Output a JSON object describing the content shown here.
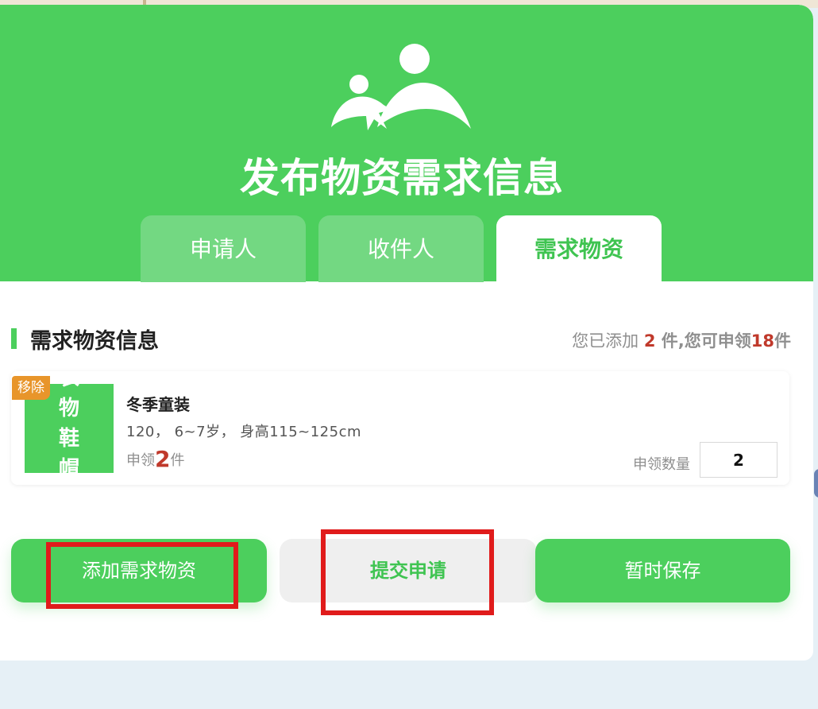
{
  "header": {
    "title": "发布物资需求信息",
    "logo_icon": "people-logo-icon",
    "background_color": "#4ccf5d"
  },
  "tabs": [
    {
      "label": "申请人",
      "active": false
    },
    {
      "label": "收件人",
      "active": false
    },
    {
      "label": "需求物资",
      "active": true
    }
  ],
  "section": {
    "title": "需求物资信息",
    "summary_prefix": "您已添加 ",
    "added_count": "2",
    "summary_middle": " 件,您可申领",
    "claimable_count": "18",
    "summary_suffix": "件"
  },
  "item": {
    "category_text": [
      "衣",
      "物",
      "鞋",
      "帽"
    ],
    "remove_label": "移除",
    "name": "冬季童装",
    "spec": "120， 6~7岁， 身高115~125cm",
    "claim_prefix": "申领",
    "claim_count": "2",
    "claim_suffix": "件",
    "qty_label": "申领数量",
    "qty_value": "2"
  },
  "actions": {
    "add_label": "添加需求物资",
    "submit_label": "提交申请",
    "save_label": "暂时保存"
  },
  "colors": {
    "primary": "#4ccf5d",
    "accent_red": "#c0392b",
    "badge_orange": "#e8952a",
    "highlight_red": "#e01b1b"
  }
}
